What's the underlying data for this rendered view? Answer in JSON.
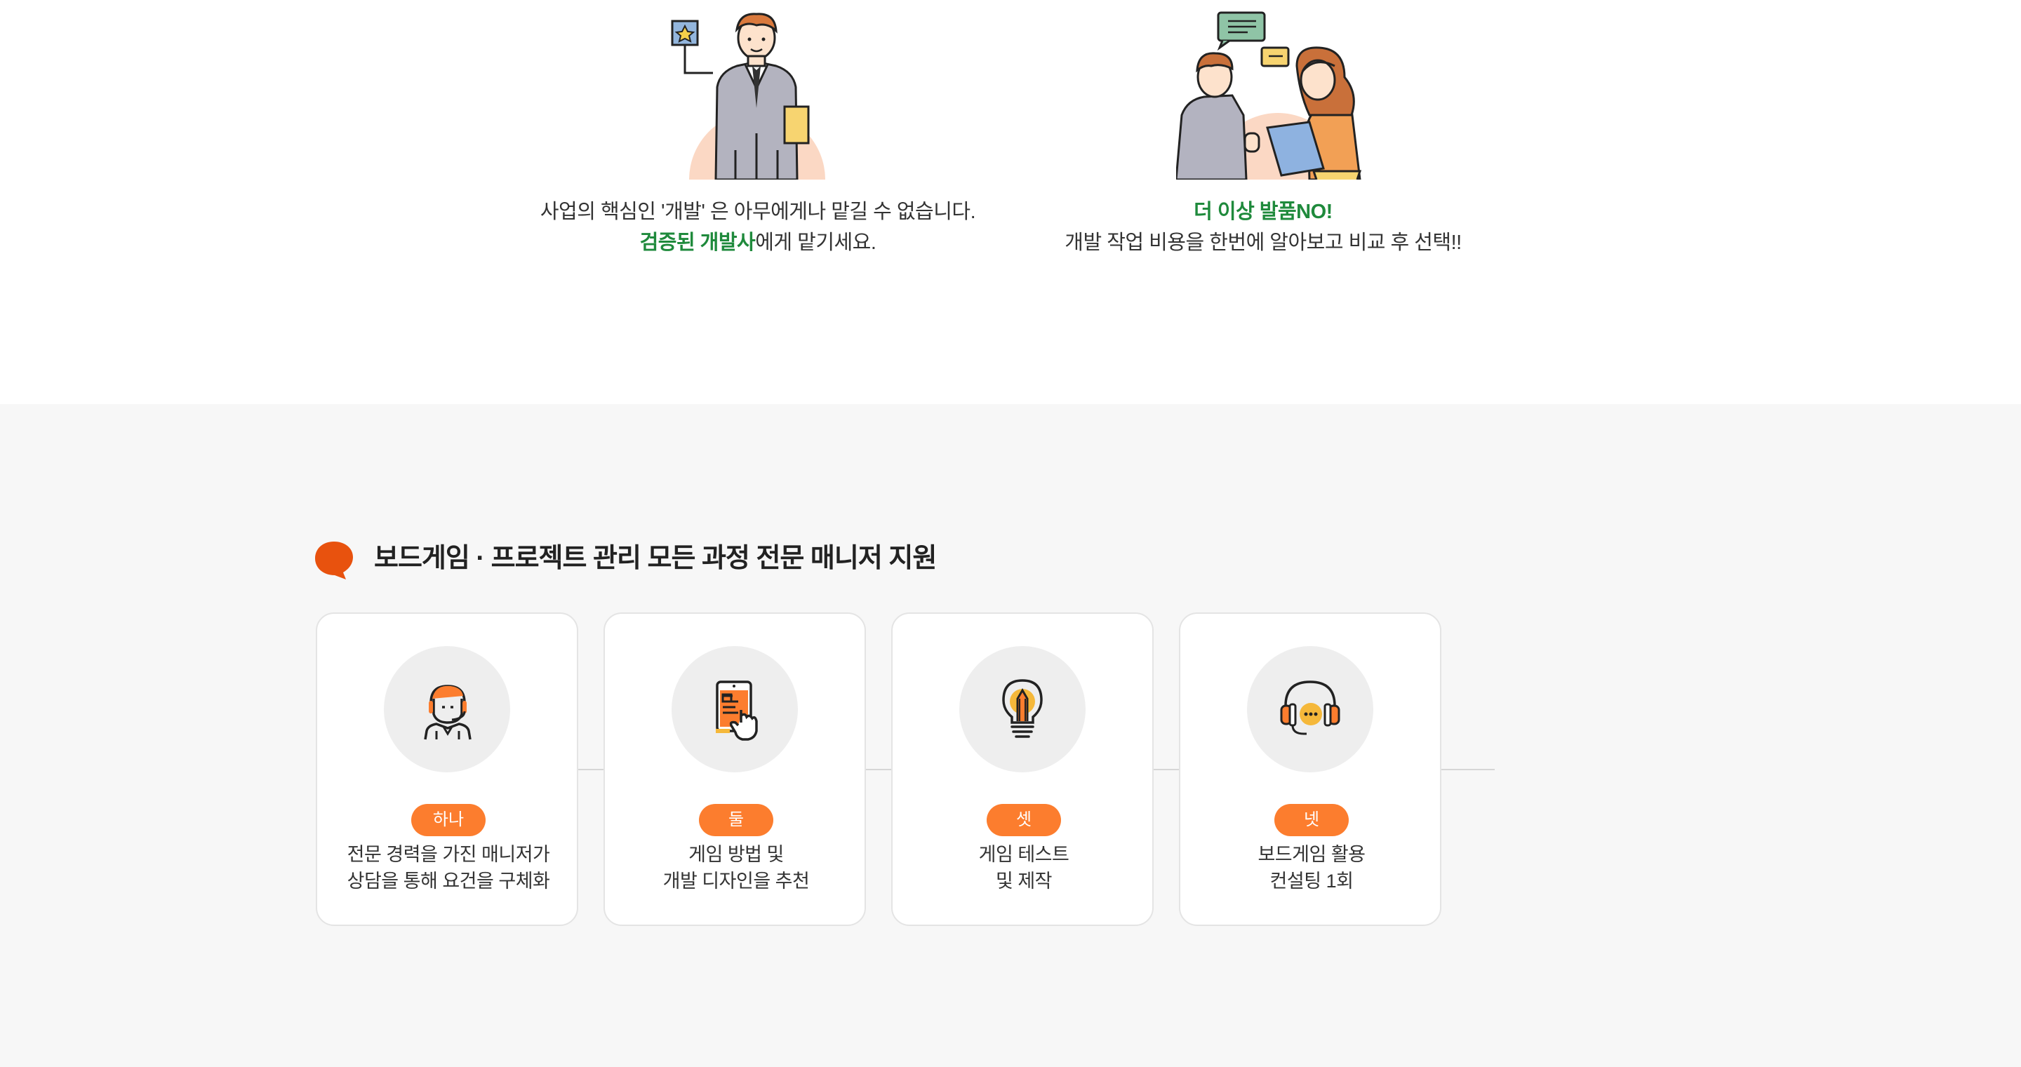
{
  "intro": {
    "left": {
      "line1": "사업의 핵심인 '개발' 은 아무에게나 맡길 수 없습니다.",
      "line2_highlight": "검증된 개발사",
      "line2_rest": "에게 맡기세요.",
      "illustration": "businessman-illustration"
    },
    "right": {
      "line1_highlight": "더 이상 발품NO!",
      "line2": "개발 작업 비용을 한번에 알아보고 비교 후 선택!!",
      "illustration": "consultation-illustration"
    }
  },
  "section": {
    "title": "보드게임 · 프로젝트 관리 모든 과정 전문 매니저 지원",
    "title_icon": "speech-bubble-icon",
    "accent_color": "#e8520e"
  },
  "cards": [
    {
      "badge": "하나",
      "line1": "전문 경력을 가진 매니저가",
      "line2": "상담을 통해 요건을 구체화",
      "icon": "manager-headset-icon"
    },
    {
      "badge": "둘",
      "line1": "게임 방법 및",
      "line2": "개발 디자인을 추천",
      "icon": "tablet-touch-icon"
    },
    {
      "badge": "셋",
      "line1": "게임 테스트",
      "line2": "및 제작",
      "icon": "lightbulb-pencil-icon"
    },
    {
      "badge": "넷",
      "line1": "보드게임 활용",
      "line2": "컨설팅 1회",
      "icon": "headphones-chat-icon"
    }
  ],
  "colors": {
    "badge": "#fc7d2e",
    "highlight_green": "#1f8a3c",
    "gray_bg": "#f7f7f7"
  }
}
